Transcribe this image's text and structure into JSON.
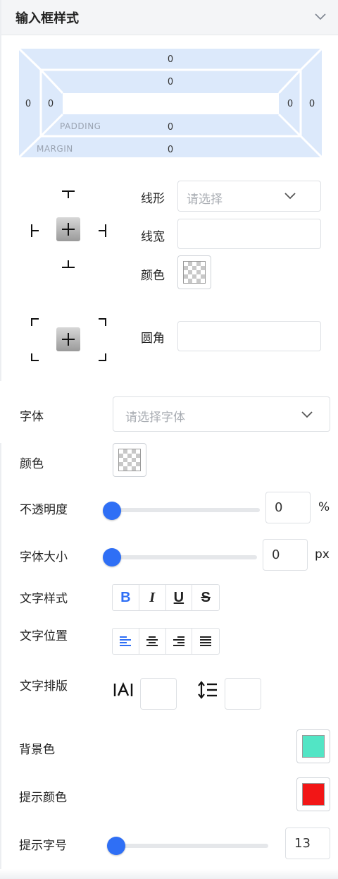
{
  "panel": {
    "title": "输入框样式"
  },
  "box_model": {
    "margin_label": "MARGIN",
    "padding_label": "PADDING",
    "margin_top": "0",
    "margin_right": "0",
    "margin_bottom": "0",
    "margin_left": "0",
    "padding_top": "0",
    "padding_right": "0",
    "padding_bottom": "0",
    "padding_left": "0"
  },
  "border": {
    "line_style_label": "线形",
    "line_style_placeholder": "请选择",
    "line_width_label": "线宽",
    "line_width_value": "",
    "color_label": "颜色",
    "radius_label": "圆角",
    "radius_value": ""
  },
  "font": {
    "family_label": "字体",
    "family_placeholder": "请选择字体",
    "color_label": "颜色",
    "opacity_label": "不透明度",
    "opacity_value": "0",
    "opacity_unit": "%",
    "opacity_level": 0,
    "size_label": "字体大小",
    "size_value": "0",
    "size_unit": "px",
    "size_level": 0,
    "style_label": "文字样式",
    "style_buttons": [
      "B",
      "I",
      "U",
      "S"
    ],
    "align_label": "文字位置",
    "layout_label": "文字排版",
    "letter_spacing_value": "",
    "line_height_value": ""
  },
  "background": {
    "label": "背景色",
    "color": "#52e5c5"
  },
  "hint": {
    "color_label": "提示颜色",
    "color": "#f21616",
    "size_label": "提示字号",
    "size_value": "13",
    "size_level": 0
  },
  "colors": {
    "accent": "#2f6ff5",
    "box_model_fill": "#dce9fb"
  }
}
